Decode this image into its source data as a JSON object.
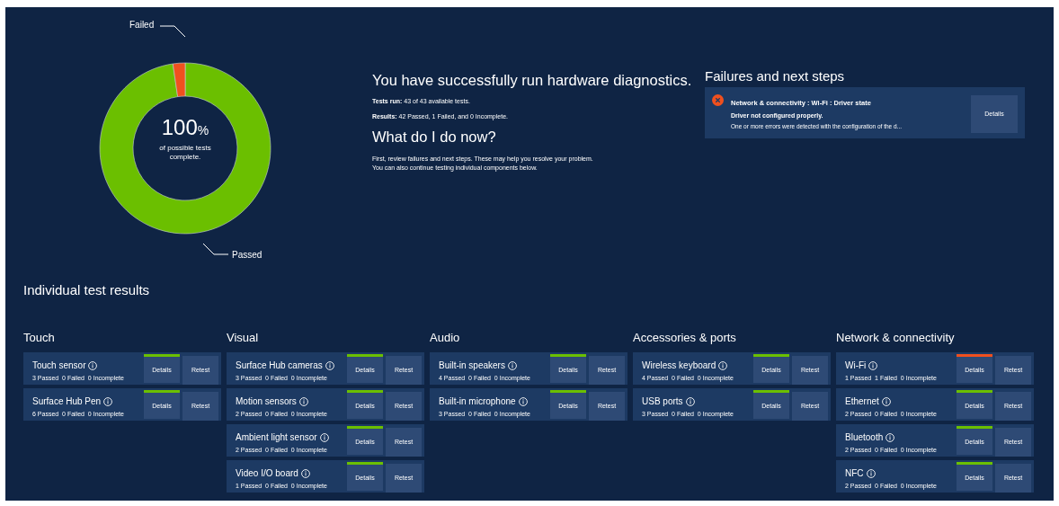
{
  "summary_chart": {
    "center_value": "100",
    "center_unit": "%",
    "center_caption": "of possible tests complete.",
    "chart_data": {
      "type": "donut",
      "categories": [
        "Passed",
        "Failed"
      ],
      "values": [
        97.7,
        2.3
      ]
    }
  },
  "summary": {
    "title": "You have successfully run hardware diagnostics.",
    "lines": [
      "**Tests run:** 43 of 43 available tests.",
      "**Results:** 42 Passed, 1 Failed, and 0 Incomplete."
    ],
    "next_title": "What do I do now?",
    "next_text": [
      "First, review failures and next steps.  These may help you resolve your problem.",
      "You can also continue testing individual components below."
    ]
  },
  "failures": {
    "title": "Failures and next steps",
    "items": [
      {
        "heading": "Network & connectivity : Wi-Fi : Driver state",
        "subtitle": "Driver not configured properly.",
        "detail": "One or more errors were detected with the configuration of the d...",
        "button": "Details"
      }
    ]
  },
  "results": {
    "title": "Individual test results",
    "groups": [
      {
        "name": "Touch",
        "tests": [
          {
            "name": "Touch sensor",
            "counts": "3 Passed  0 Failed  0 Incomplete",
            "failed": false,
            "details": "Details",
            "retest": "Retest"
          },
          {
            "name": "Surface Hub Pen",
            "counts": "6 Passed  0 Failed  0 Incomplete",
            "failed": false,
            "details": "Details",
            "retest": "Retest"
          }
        ]
      },
      {
        "name": "Visual",
        "tests": [
          {
            "name": "Surface Hub cameras",
            "counts": "3 Passed  0 Failed  0 Incomplete",
            "failed": false,
            "details": "Details",
            "retest": "Retest"
          },
          {
            "name": "Motion sensors",
            "counts": "2 Passed  0 Failed  0 Incomplete",
            "failed": false,
            "details": "Details",
            "retest": "Retest"
          },
          {
            "name": "Ambient light sensor",
            "counts": "2 Passed  0 Failed  0 Incomplete",
            "failed": false,
            "details": "Details",
            "retest": "Retest"
          },
          {
            "name": "Video I/O board",
            "counts": "1 Passed  0 Failed  0 Incomplete",
            "failed": false,
            "details": "Details",
            "retest": "Retest"
          }
        ]
      },
      {
        "name": "Audio",
        "tests": [
          {
            "name": "Built-in speakers",
            "counts": "4 Passed  0 Failed  0 Incomplete",
            "failed": false,
            "details": "Details",
            "retest": "Retest"
          },
          {
            "name": "Built-in microphone",
            "counts": "3 Passed  0 Failed  0 Incomplete",
            "failed": false,
            "details": "Details",
            "retest": "Retest"
          }
        ]
      },
      {
        "name": "Accessories & ports",
        "tests": [
          {
            "name": "Wireless keyboard",
            "counts": "4 Passed  0 Failed  0 Incomplete",
            "failed": false,
            "details": "Details",
            "retest": "Retest"
          },
          {
            "name": "USB ports",
            "counts": "3 Passed  0 Failed  0 Incomplete",
            "failed": false,
            "details": "Details",
            "retest": "Retest"
          }
        ]
      },
      {
        "name": "Network & connectivity",
        "tests": [
          {
            "name": "Wi-Fi",
            "counts": "1 Passed  1 Failed  0 Incomplete",
            "failed": true,
            "details": "Details",
            "retest": "Retest"
          },
          {
            "name": "Ethernet",
            "counts": "2 Passed  0 Failed  0 Incomplete",
            "failed": false,
            "details": "Details",
            "retest": "Retest"
          },
          {
            "name": "Bluetooth",
            "counts": "2 Passed  0 Failed  0 Incomplete",
            "failed": false,
            "details": "Details",
            "retest": "Retest"
          },
          {
            "name": "NFC",
            "counts": "2 Passed  0 Failed  0 Incomplete",
            "failed": false,
            "details": "Details",
            "retest": "Retest"
          }
        ]
      }
    ]
  }
}
